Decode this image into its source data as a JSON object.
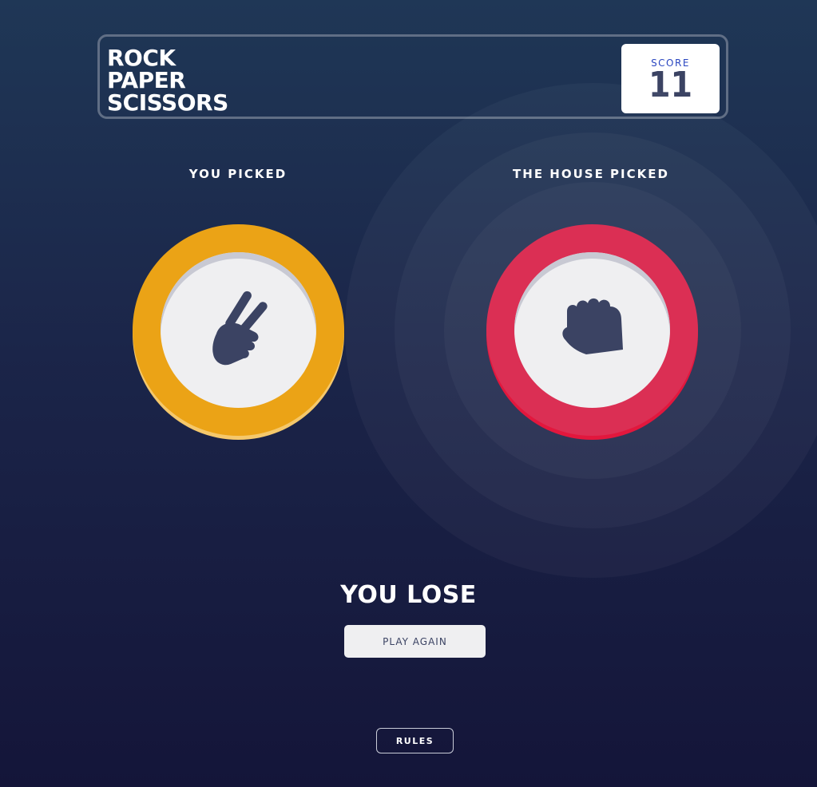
{
  "header": {
    "logo_lines": [
      "ROCK",
      "PAPER",
      "SCISSORS"
    ],
    "score_label": "SCORE",
    "score_value": "11"
  },
  "player": {
    "label": "YOU PICKED",
    "pick": "scissors",
    "icon": "scissors-hand-icon",
    "color": "#eba316"
  },
  "house": {
    "label": "THE HOUSE PICKED",
    "pick": "rock",
    "icon": "rock-fist-icon",
    "color": "#db2f54",
    "winner": true
  },
  "result": {
    "text": "YOU LOSE",
    "play_again_label": "PLAY AGAIN"
  },
  "footer": {
    "rules_label": "RULES"
  }
}
